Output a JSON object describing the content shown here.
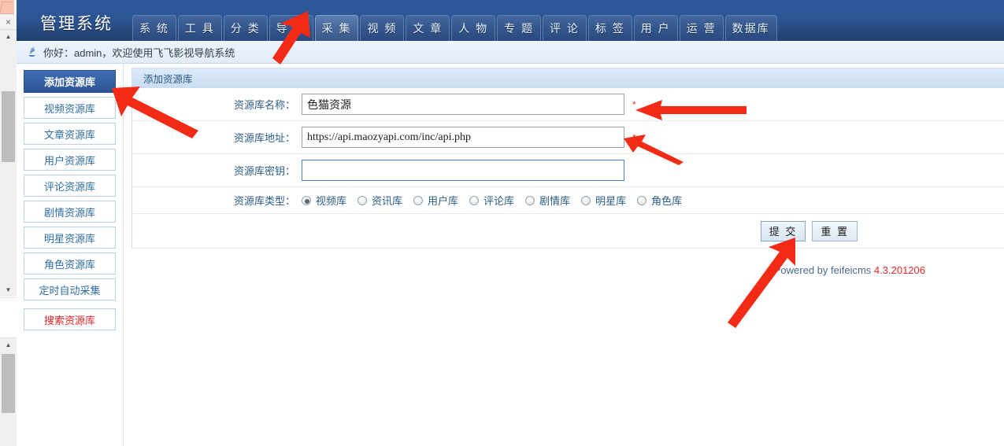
{
  "browser_chrome": {
    "close_icon": "×",
    "scroll_up_glyph": "▲",
    "scroll_down_glyph": "▼"
  },
  "header": {
    "logo": "管理系统",
    "nav_tabs": [
      {
        "label": "系 统",
        "active": false
      },
      {
        "label": "工 具",
        "active": false
      },
      {
        "label": "分 类",
        "active": false
      },
      {
        "label": "导 航",
        "active": false
      },
      {
        "label": "采 集",
        "active": true
      },
      {
        "label": "视 频",
        "active": false
      },
      {
        "label": "文 章",
        "active": false
      },
      {
        "label": "人 物",
        "active": false
      },
      {
        "label": "专 题",
        "active": false
      },
      {
        "label": "评 论",
        "active": false
      },
      {
        "label": "标 签",
        "active": false
      },
      {
        "label": "用 户",
        "active": false
      },
      {
        "label": "运 营",
        "active": false
      },
      {
        "label": "数据库",
        "active": false
      }
    ]
  },
  "welcome": {
    "icon": "signal-icon",
    "text": "你好：admin，欢迎使用飞飞影视导航系统"
  },
  "sidebar": {
    "items": [
      {
        "label": "添加资源库",
        "state": "active"
      },
      {
        "label": "视频资源库",
        "state": "normal"
      },
      {
        "label": "文章资源库",
        "state": "normal"
      },
      {
        "label": "用户资源库",
        "state": "normal"
      },
      {
        "label": "评论资源库",
        "state": "normal"
      },
      {
        "label": "剧情资源库",
        "state": "normal"
      },
      {
        "label": "明星资源库",
        "state": "normal"
      },
      {
        "label": "角色资源库",
        "state": "normal"
      },
      {
        "label": "定时自动采集",
        "state": "normal"
      },
      {
        "label": "搜索资源库",
        "state": "danger"
      }
    ]
  },
  "panel": {
    "title": "添加资源库",
    "fields": [
      {
        "label": "资源库名称：",
        "value": "色猫资源",
        "placeholder": "",
        "required_mark": "*",
        "focused": false
      },
      {
        "label": "资源库地址：",
        "value": "https://api.maozyapi.com/inc/api.php",
        "placeholder": "",
        "required_mark": "*",
        "focused": false
      },
      {
        "label": "资源库密钥：",
        "value": "",
        "placeholder": "",
        "required_mark": "",
        "focused": true
      }
    ],
    "type_row": {
      "label": "资源库类型：",
      "options": [
        {
          "label": "视频库",
          "checked": true
        },
        {
          "label": "资讯库",
          "checked": false
        },
        {
          "label": "用户库",
          "checked": false
        },
        {
          "label": "评论库",
          "checked": false
        },
        {
          "label": "剧情库",
          "checked": false
        },
        {
          "label": "明星库",
          "checked": false
        },
        {
          "label": "角色库",
          "checked": false
        }
      ]
    },
    "buttons": {
      "submit": "提 交",
      "reset": "重 置"
    }
  },
  "footer": {
    "powered_text": "Powered by feifeicms ",
    "version": "4.3.201206"
  },
  "colors": {
    "header_blue": "#2b5494",
    "accent_blue": "#2e6da4",
    "danger_red": "#e8262a",
    "arrow_red": "#f22a16",
    "panel_head": "#cfe2f5"
  }
}
